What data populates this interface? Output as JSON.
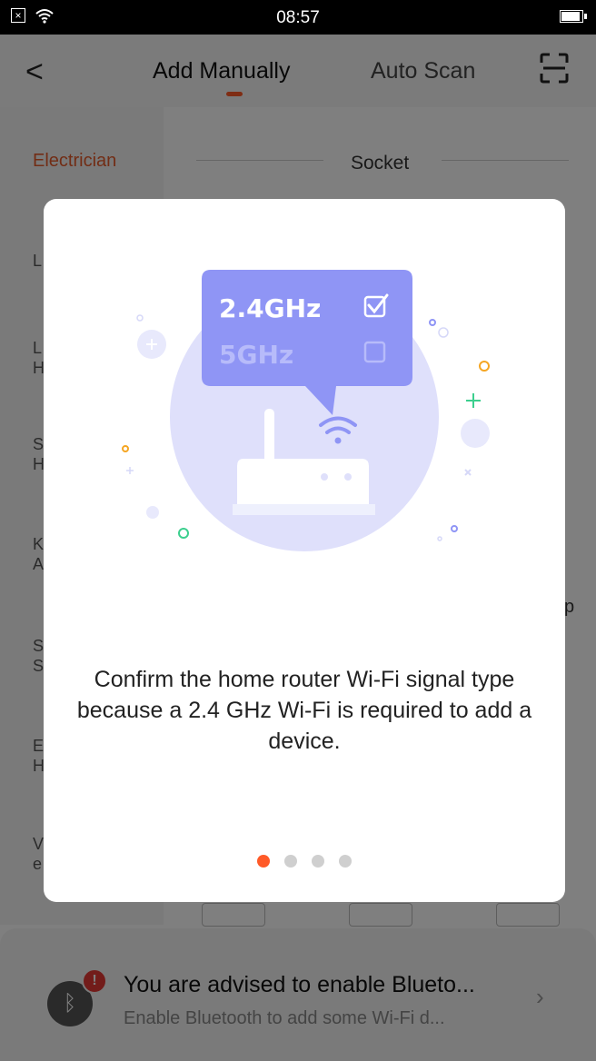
{
  "status_bar": {
    "time": "08:57"
  },
  "header": {
    "back": "<",
    "tab_manual": "Add Manually",
    "tab_auto": "Auto Scan"
  },
  "category": {
    "active": "Electrician",
    "section": "Socket"
  },
  "sidebar_fragments": [
    "L",
    "L\nH",
    "S\nH",
    "K\nA",
    "S\nS",
    "E\nH",
    "V\ne"
  ],
  "right_fragment": "p",
  "bluetooth": {
    "title": "You are advised to enable Blueto...",
    "subtitle": "Enable Bluetooth to add some Wi-Fi d...",
    "badge": "!"
  },
  "modal": {
    "band_24": "2.4GHz",
    "band_5": "5GHz",
    "message": "Confirm the home router Wi-Fi signal type because a 2.4 GHz Wi-Fi is required to add a device.",
    "pages": 4,
    "current_page": 1
  },
  "colors": {
    "accent": "#ff5a28",
    "illustration": "#8f95f5",
    "circle": "#dfe0fb"
  }
}
